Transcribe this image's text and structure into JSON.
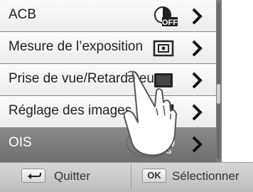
{
  "menu": {
    "items": [
      {
        "label": "ACB",
        "icon": "acb-off-icon"
      },
      {
        "label": "Mesure de l’exposition",
        "icon": "metering-icon"
      },
      {
        "label": "Prise de vue/Retardateur",
        "icon": "drive-mode-icon"
      },
      {
        "label": "Réglage des images",
        "icon": "image-adjust-icon"
      },
      {
        "label": "OIS",
        "icon": "ois-icon"
      }
    ],
    "icon_off_text": "OFF",
    "icon_ois_text": "OIS"
  },
  "footer": {
    "back_label": "Quitter",
    "ok_key": "OK",
    "select_label": "Sélectionner"
  },
  "colors": {
    "panel": "#7d7d7d",
    "row_light": "#f5f5f5",
    "row_dark": "#7a7a7a",
    "footer": "#cccccc"
  }
}
